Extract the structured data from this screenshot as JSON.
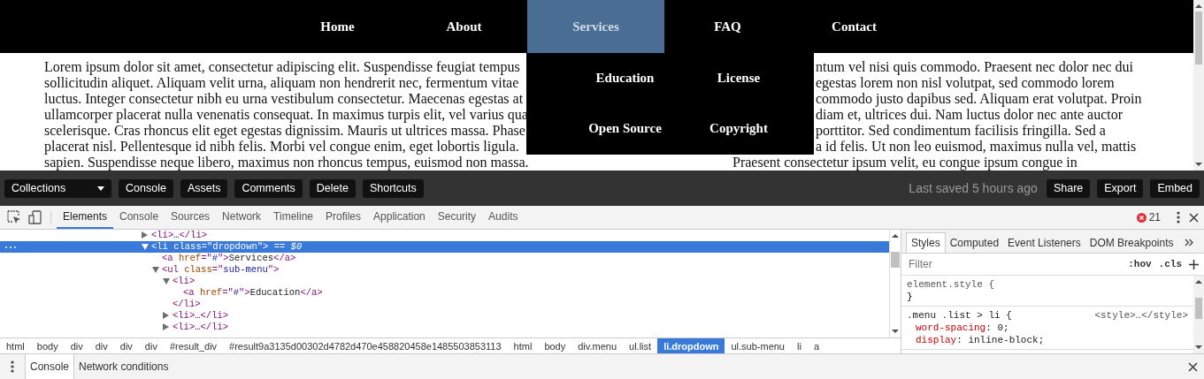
{
  "site": {
    "nav": {
      "items": [
        {
          "label": "Home",
          "selected": false
        },
        {
          "label": "About",
          "selected": false
        },
        {
          "label": "Services",
          "selected": true
        },
        {
          "label": "FAQ",
          "selected": false
        },
        {
          "label": "Contact",
          "selected": false
        }
      ]
    },
    "sub_menu": {
      "columns": [
        [
          {
            "label": "Education"
          },
          {
            "label": "Open Source"
          }
        ],
        [
          {
            "label": "License"
          },
          {
            "label": "Copyright"
          }
        ]
      ]
    },
    "text_lines": [
      {
        "left": "Lorem ipsum dolor sit amet, consectetur adipiscing elit. Suspendisse feugiat tempus",
        "right": "ntum vel nisi quis commodo. Praesent nec dolor nec dui"
      },
      {
        "left": "sollicitudin aliquet. Aliquam velit urna, aliquam non hendrerit nec, fermentum vitae",
        "right": "egestas lorem non nisl volutpat, sed commodo lorem"
      },
      {
        "left": "luctus. Integer consectetur nibh eu urna vestibulum consectetur. Maecenas egestas at",
        "right": "commodo justo dapibus sed. Aliquam erat volutpat. Proin"
      },
      {
        "left": "ullamcorper placerat nulla venenatis consequat. In maximus turpis elit, vel varius qua",
        "right": "diam et, ultrices dui. Nam luctus dolor nec ante auctor"
      },
      {
        "left": "scelerisque. Cras rhoncus elit eget egestas dignissim. Mauris ut ultrices massa. Phase",
        "right": "porttitor. Sed condimentum facilisis fringilla. Sed a"
      },
      {
        "left": "placerat nisl. Pellentesque id nibh felis. Morbi vel congue enim, eget lobortis ligula.",
        "right": "a id felis. Ut non leo euismod, maximus nulla vel, mattis"
      },
      {
        "left": "sapien. Suspendisse neque libero, maximus non rhoncus tempus, euismod non massa.",
        "right": "Praesent consectetur ipsum velit, eu congue ipsum congue in"
      }
    ]
  },
  "toolbar": {
    "collections": "Collections",
    "left_buttons": [
      "Console",
      "Assets",
      "Comments",
      "Delete",
      "Shortcuts"
    ],
    "status": "Last saved 5 hours ago",
    "right_buttons": [
      "Share",
      "Export",
      "Embed"
    ]
  },
  "devtools": {
    "tabs": [
      {
        "label": "Elements",
        "selected": true
      },
      {
        "label": "Console",
        "selected": false
      },
      {
        "label": "Sources",
        "selected": false
      },
      {
        "label": "Network",
        "selected": false
      },
      {
        "label": "Timeline",
        "selected": false
      },
      {
        "label": "Profiles",
        "selected": false
      },
      {
        "label": "Application",
        "selected": false
      },
      {
        "label": "Security",
        "selected": false
      },
      {
        "label": "Audits",
        "selected": false
      }
    ],
    "error_count": "21",
    "dom_tree": [
      {
        "expanded": false,
        "selected": false,
        "parts": [
          {
            "kind": "tag",
            "text": "<li>"
          },
          {
            "kind": "text",
            "text": "…"
          },
          {
            "kind": "tag",
            "text": "</li>"
          }
        ]
      },
      {
        "expanded": true,
        "selected": true,
        "parts": [
          {
            "kind": "tag",
            "text": "<li"
          },
          {
            "kind": "attr",
            "text": " class"
          },
          {
            "kind": "tag",
            "text": "=\""
          },
          {
            "kind": "value",
            "text": "dropdown"
          },
          {
            "kind": "tag",
            "text": "\">"
          },
          {
            "kind": "text",
            "text": " == "
          },
          {
            "kind": "marker",
            "text": "$0"
          }
        ],
        "children": [
          {
            "selected": false,
            "parts": [
              {
                "kind": "tag",
                "text": "<a"
              },
              {
                "kind": "attr",
                "text": " href"
              },
              {
                "kind": "tag",
                "text": "=\""
              },
              {
                "kind": "value",
                "text": "#"
              },
              {
                "kind": "tag",
                "text": "\">"
              },
              {
                "kind": "text",
                "text": "Services"
              },
              {
                "kind": "tag",
                "text": "</a>"
              }
            ]
          },
          {
            "expanded": true,
            "selected": false,
            "parts": [
              {
                "kind": "tag",
                "text": "<ul"
              },
              {
                "kind": "attr",
                "text": " class"
              },
              {
                "kind": "tag",
                "text": "=\""
              },
              {
                "kind": "value",
                "text": "sub-menu"
              },
              {
                "kind": "tag",
                "text": "\">"
              }
            ],
            "children": [
              {
                "expanded": true,
                "selected": false,
                "parts": [
                  {
                    "kind": "tag",
                    "text": "<li>"
                  }
                ],
                "closing": "</li>",
                "children": [
                  {
                    "selected": false,
                    "parts": [
                      {
                        "kind": "tag",
                        "text": "<a"
                      },
                      {
                        "kind": "attr",
                        "text": " href"
                      },
                      {
                        "kind": "tag",
                        "text": "=\""
                      },
                      {
                        "kind": "value",
                        "text": "#"
                      },
                      {
                        "kind": "tag",
                        "text": "\">"
                      },
                      {
                        "kind": "text",
                        "text": "Education"
                      },
                      {
                        "kind": "tag",
                        "text": "</a>"
                      }
                    ]
                  }
                ]
              },
              {
                "expanded": false,
                "selected": false,
                "parts": [
                  {
                    "kind": "tag",
                    "text": "<li>"
                  },
                  {
                    "kind": "text",
                    "text": "…"
                  },
                  {
                    "kind": "tag",
                    "text": "</li>"
                  }
                ]
              },
              {
                "expanded": false,
                "selected": false,
                "parts": [
                  {
                    "kind": "tag",
                    "text": "<li>"
                  },
                  {
                    "kind": "text",
                    "text": "…"
                  },
                  {
                    "kind": "tag",
                    "text": "</li>"
                  }
                ]
              }
            ]
          }
        ]
      }
    ],
    "breadcrumbs": [
      {
        "label": "html",
        "selected": false
      },
      {
        "label": "body",
        "selected": false
      },
      {
        "label": "div",
        "selected": false
      },
      {
        "label": "div",
        "selected": false
      },
      {
        "label": "div",
        "selected": false
      },
      {
        "label": "div",
        "selected": false
      },
      {
        "label": "#result_div",
        "selected": false
      },
      {
        "label": "#result9a3135d00302d4782d470e458820458e1485503853113",
        "selected": false
      },
      {
        "label": "html",
        "selected": false
      },
      {
        "label": "body",
        "selected": false
      },
      {
        "label": "div.menu",
        "selected": false
      },
      {
        "label": "ul.list",
        "selected": false
      },
      {
        "label": "li.dropdown",
        "selected": true
      },
      {
        "label": "ul.sub-menu",
        "selected": false
      },
      {
        "label": "li",
        "selected": false
      },
      {
        "label": "a",
        "selected": false
      }
    ],
    "styles_tabs": [
      {
        "label": "Styles",
        "selected": true
      },
      {
        "label": "Computed",
        "selected": false
      },
      {
        "label": "Event Listeners",
        "selected": false
      },
      {
        "label": "DOM Breakpoints",
        "selected": false
      }
    ],
    "filter": {
      "placeholder": "Filter"
    },
    "filter_buttons": [
      ":hov",
      ".cls"
    ],
    "rules": [
      {
        "selector": "element.style {",
        "closing": "}"
      },
      {
        "selector": ".menu .list > li {",
        "source": "<style>…</style>",
        "declarations": [
          {
            "property": "word-spacing",
            "rest": ": 0;"
          },
          {
            "property": "display",
            "rest": ": inline-block;"
          }
        ]
      }
    ],
    "drawer_tabs": [
      {
        "label": "Console",
        "selected": true
      },
      {
        "label": "Network conditions",
        "selected": false
      }
    ]
  }
}
